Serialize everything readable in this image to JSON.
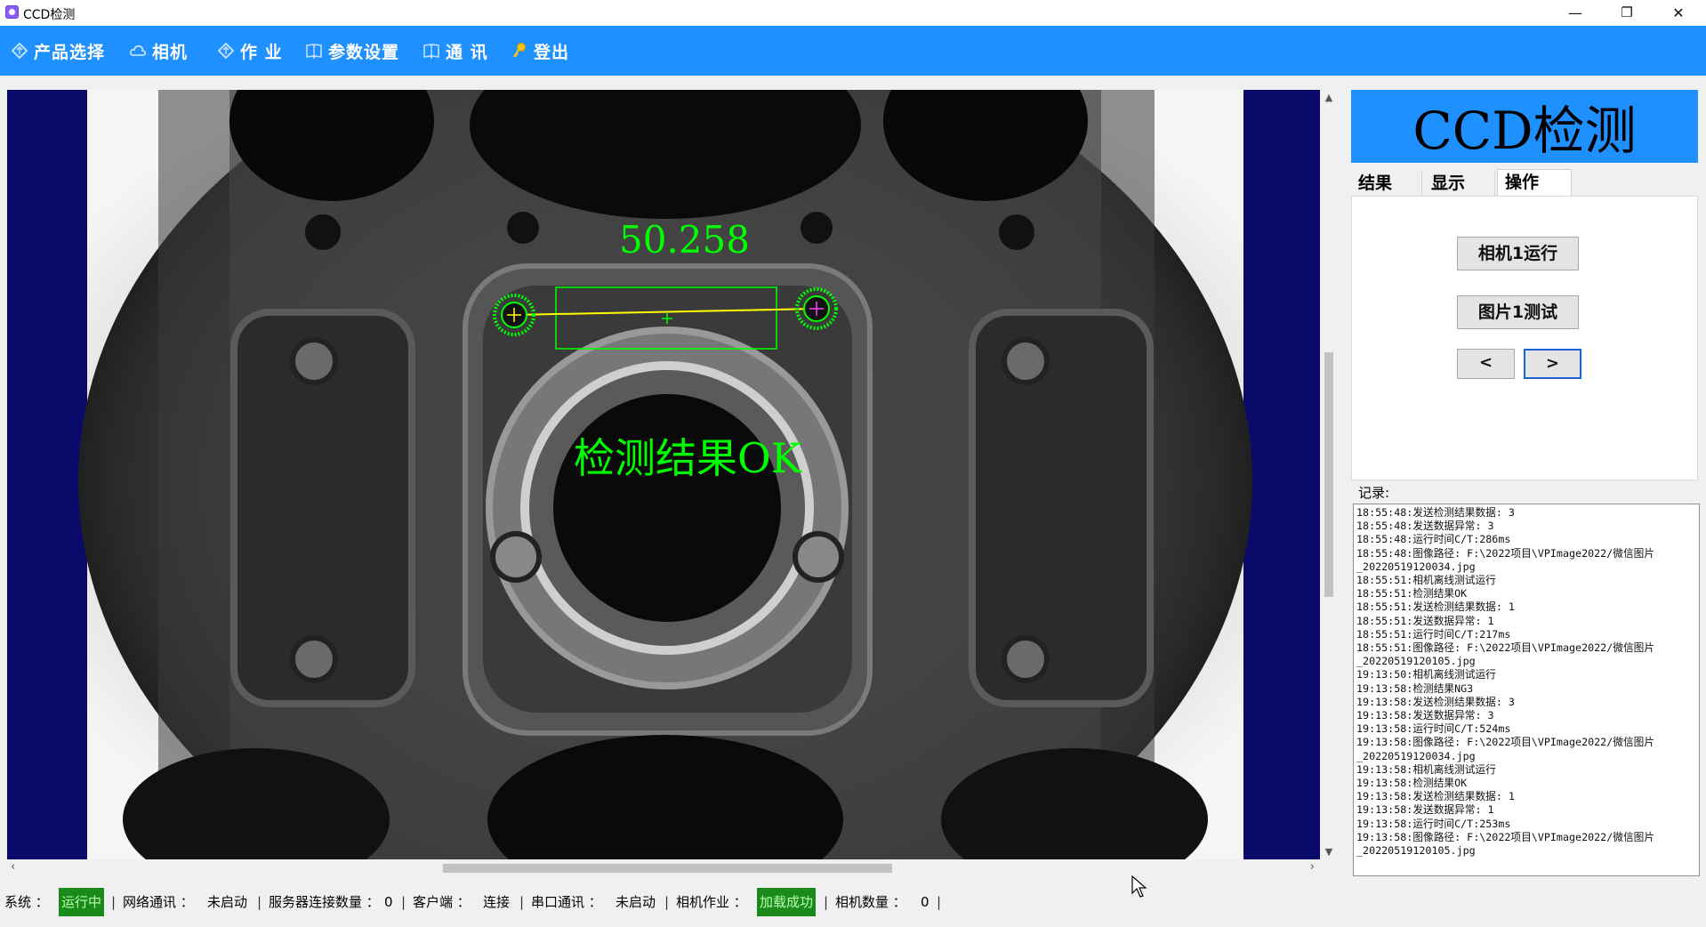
{
  "window": {
    "title": "CCD检测",
    "minimize": "—",
    "restore": "❐",
    "close": "✕"
  },
  "menu": [
    {
      "label": "产品选择",
      "icon": "diamond-arrow-icon"
    },
    {
      "label": "相机",
      "icon": "cloud-icon"
    },
    {
      "label": "作 业",
      "icon": "diamond-arrow-icon"
    },
    {
      "label": "参数设置",
      "icon": "book-icon"
    },
    {
      "label": "通 讯",
      "icon": "book-icon"
    },
    {
      "label": "登出",
      "icon": "key-icon"
    }
  ],
  "viewer": {
    "measurement": "50.258",
    "result_text": "检测结果OK",
    "overlay_color": "#00ff00"
  },
  "panel": {
    "brand": "CCD检测",
    "tabs": [
      "结果",
      "显示",
      "操作"
    ],
    "active_tab": "操作",
    "buttons": {
      "camera_run": "相机1运行",
      "image_test": "图片1测试",
      "prev": "<",
      "next": ">"
    },
    "log_label": "记录:"
  },
  "log": [
    "18:55:48:发送检测结果数据: 3",
    "18:55:48:发送数据异常: 3",
    "18:55:48:运行时间C/T:286ms",
    "18:55:48:图像路径: F:\\2022项目\\VPImage2022/微信图片",
    "_20220519120034.jpg",
    "18:55:51:相机离线测试运行",
    "18:55:51:检测结果OK",
    "18:55:51:发送检测结果数据: 1",
    "18:55:51:发送数据异常: 1",
    "18:55:51:运行时间C/T:217ms",
    "18:55:51:图像路径: F:\\2022项目\\VPImage2022/微信图片",
    "_20220519120105.jpg",
    "19:13:50:相机离线测试运行",
    "19:13:58:检测结果NG3",
    "19:13:58:发送检测结果数据: 3",
    "19:13:58:发送数据异常: 3",
    "19:13:58:运行时间C/T:524ms",
    "19:13:58:图像路径: F:\\2022项目\\VPImage2022/微信图片",
    "_20220519120034.jpg",
    "19:13:58:相机离线测试运行",
    "19:13:58:检测结果OK",
    "19:13:58:发送检测结果数据: 1",
    "19:13:58:发送数据异常: 1",
    "19:13:58:运行时间C/T:253ms",
    "19:13:58:图像路径: F:\\2022项目\\VPImage2022/微信图片",
    "_20220519120105.jpg"
  ],
  "status": {
    "system_label": "系统 ：",
    "system_value": "运行中",
    "network_label": "网络通讯 ：",
    "network_value": "未启动",
    "server_conn_label": "服务器连接数量 ：",
    "server_conn_value": "0",
    "client_label": "客户端 ：",
    "client_value": "连接",
    "serial_label": "串口通讯 ：",
    "serial_value": "未启动",
    "camera_job_label": "相机作业 ：",
    "camera_job_value": "加载成功",
    "camera_count_label": "相机数量 ：",
    "camera_count_value": "0",
    "separator": "|"
  },
  "colors": {
    "menu_blue": "#1e90ff",
    "status_green": "#1a8a1a",
    "viewer_bg": "#0a0a6a"
  }
}
